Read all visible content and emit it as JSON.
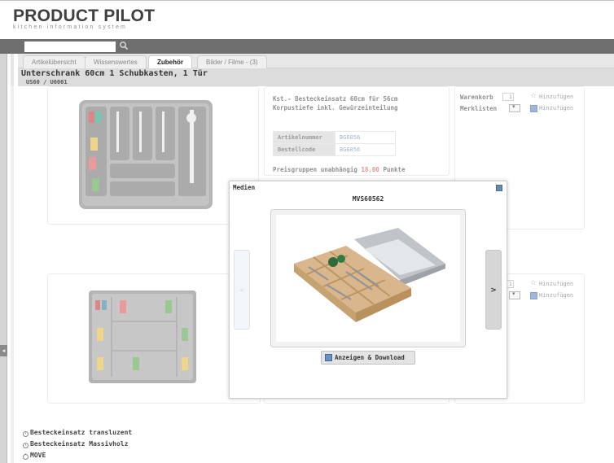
{
  "app": {
    "logo_text": "PRODUCT PILOT",
    "logo_subtitle": "kitchen information system"
  },
  "tabs": [
    {
      "label": "Artikelübersicht"
    },
    {
      "label": "Wissenswertes"
    },
    {
      "label": "Zubehör"
    },
    {
      "label": "Bilder / Filme - (3)"
    }
  ],
  "active_tab": "Zubehör",
  "page": {
    "title": "Unterschrank 60cm 1 Schubkasten, 1 Tür",
    "subtitle": "US60 / U6001"
  },
  "product1": {
    "description_line1": "Kst.- Besteckeinsatz 60cm für 56cm",
    "description_line2": "Korpustiefe inkl. Gewürzeinteilung",
    "spec": [
      {
        "key": "Artikelnummer",
        "value": "BG6056"
      },
      {
        "key": "Bestellcode",
        "value": "BG6056"
      }
    ],
    "price_prefix": "Preisgruppen unabhängig",
    "price_value": "18,00",
    "price_suffix": "Punkte",
    "warenkorb_label": "Warenkorb",
    "warenkorb_qty": "1",
    "merklisten_label": "Merklisten",
    "add_label_1": "Hinzufügen",
    "add_label_2": "Hinzufügen"
  },
  "product2": {
    "warenkorb_qty": "1",
    "add_label_1": "Hinzufügen",
    "add_label_2": "Hinzufügen"
  },
  "accordion": [
    {
      "label": "Besteckeinsatz transluzent",
      "icon": "expand-icon"
    },
    {
      "label": "Besteckeinsatz Massivholz",
      "icon": "expand-icon"
    },
    {
      "label": "MOVE",
      "icon": "collapse-icon"
    }
  ],
  "modal": {
    "title": "Medien",
    "code": "MVS60562",
    "prev_label": "<",
    "next_label": ">",
    "download_label": "Anzeigen & Download"
  },
  "colors": {
    "navbar": "#6e6e6e",
    "link_blue": "#6b8db3",
    "price_red": "#d45a5a"
  }
}
